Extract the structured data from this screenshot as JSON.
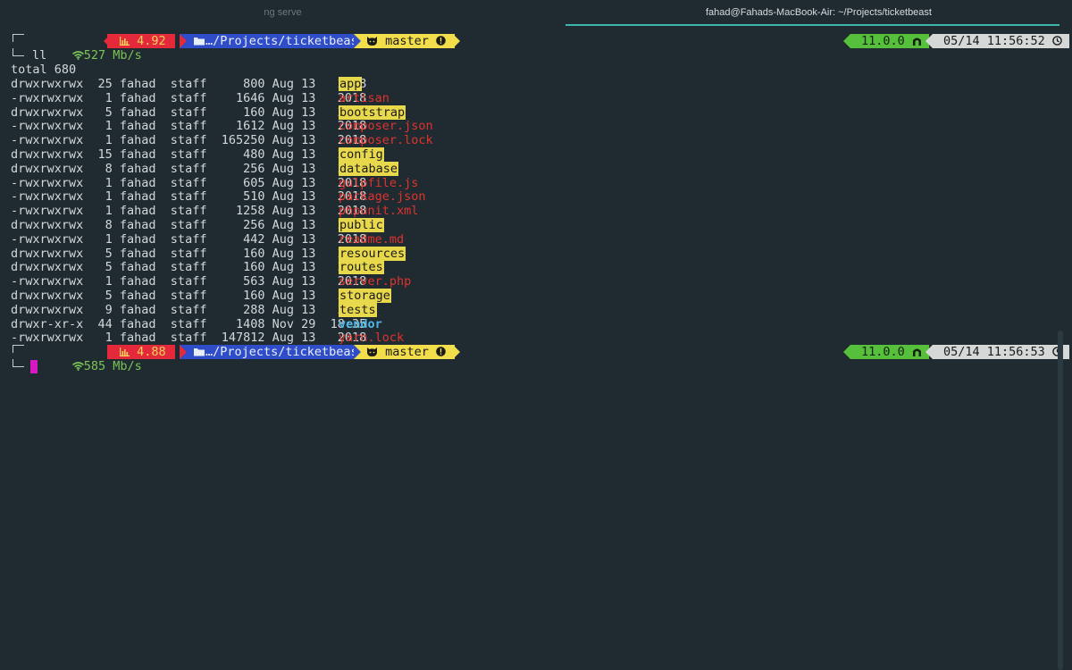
{
  "tabs": {
    "inactive": "ng serve",
    "active": "fahad@Fahads-MacBook-Air: ~/Projects/ticketbeast"
  },
  "prompt1": {
    "net": "527 Mb/s",
    "cpu": "4.92",
    "path": "…/Projects/ticketbeast",
    "branch": "master",
    "version": "11.0.0",
    "datetime": "05/14 11:56:52"
  },
  "command": "ll",
  "total": "total 680",
  "listing": [
    {
      "perm": "drwxrwxrwx",
      "links": "25",
      "user": "fahad",
      "group": "staff",
      "size": "800",
      "month": "Aug",
      "day": "13",
      "time": "2018",
      "name": "app",
      "kind": "dir"
    },
    {
      "perm": "-rwxrwxrwx",
      "links": "1",
      "user": "fahad",
      "group": "staff",
      "size": "1646",
      "month": "Aug",
      "day": "13",
      "time": "2018",
      "name": "artisan",
      "kind": "file"
    },
    {
      "perm": "drwxrwxrwx",
      "links": "5",
      "user": "fahad",
      "group": "staff",
      "size": "160",
      "month": "Aug",
      "day": "13",
      "time": "2018",
      "name": "bootstrap",
      "kind": "dir"
    },
    {
      "perm": "-rwxrwxrwx",
      "links": "1",
      "user": "fahad",
      "group": "staff",
      "size": "1612",
      "month": "Aug",
      "day": "13",
      "time": "2018",
      "name": "composer.json",
      "kind": "file"
    },
    {
      "perm": "-rwxrwxrwx",
      "links": "1",
      "user": "fahad",
      "group": "staff",
      "size": "165250",
      "month": "Aug",
      "day": "13",
      "time": "2018",
      "name": "composer.lock",
      "kind": "file"
    },
    {
      "perm": "drwxrwxrwx",
      "links": "15",
      "user": "fahad",
      "group": "staff",
      "size": "480",
      "month": "Aug",
      "day": "13",
      "time": "2018",
      "name": "config",
      "kind": "dir"
    },
    {
      "perm": "drwxrwxrwx",
      "links": "8",
      "user": "fahad",
      "group": "staff",
      "size": "256",
      "month": "Aug",
      "day": "13",
      "time": "2018",
      "name": "database",
      "kind": "dir"
    },
    {
      "perm": "-rwxrwxrwx",
      "links": "1",
      "user": "fahad",
      "group": "staff",
      "size": "605",
      "month": "Aug",
      "day": "13",
      "time": "2018",
      "name": "gulpfile.js",
      "kind": "file"
    },
    {
      "perm": "-rwxrwxrwx",
      "links": "1",
      "user": "fahad",
      "group": "staff",
      "size": "510",
      "month": "Aug",
      "day": "13",
      "time": "2018",
      "name": "package.json",
      "kind": "file"
    },
    {
      "perm": "-rwxrwxrwx",
      "links": "1",
      "user": "fahad",
      "group": "staff",
      "size": "1258",
      "month": "Aug",
      "day": "13",
      "time": "2018",
      "name": "phpunit.xml",
      "kind": "file"
    },
    {
      "perm": "drwxrwxrwx",
      "links": "8",
      "user": "fahad",
      "group": "staff",
      "size": "256",
      "month": "Aug",
      "day": "13",
      "time": "2018",
      "name": "public",
      "kind": "dir"
    },
    {
      "perm": "-rwxrwxrwx",
      "links": "1",
      "user": "fahad",
      "group": "staff",
      "size": "442",
      "month": "Aug",
      "day": "13",
      "time": "2018",
      "name": "readme.md",
      "kind": "file"
    },
    {
      "perm": "drwxrwxrwx",
      "links": "5",
      "user": "fahad",
      "group": "staff",
      "size": "160",
      "month": "Aug",
      "day": "13",
      "time": "2018",
      "name": "resources",
      "kind": "dir"
    },
    {
      "perm": "drwxrwxrwx",
      "links": "5",
      "user": "fahad",
      "group": "staff",
      "size": "160",
      "month": "Aug",
      "day": "13",
      "time": "2018",
      "name": "routes",
      "kind": "dir"
    },
    {
      "perm": "-rwxrwxrwx",
      "links": "1",
      "user": "fahad",
      "group": "staff",
      "size": "563",
      "month": "Aug",
      "day": "13",
      "time": "2018",
      "name": "server.php",
      "kind": "file"
    },
    {
      "perm": "drwxrwxrwx",
      "links": "5",
      "user": "fahad",
      "group": "staff",
      "size": "160",
      "month": "Aug",
      "day": "13",
      "time": "2018",
      "name": "storage",
      "kind": "dir"
    },
    {
      "perm": "drwxrwxrwx",
      "links": "9",
      "user": "fahad",
      "group": "staff",
      "size": "288",
      "month": "Aug",
      "day": "13",
      "time": "2018",
      "name": "tests",
      "kind": "dir"
    },
    {
      "perm": "drwxr-xr-x",
      "links": "44",
      "user": "fahad",
      "group": "staff",
      "size": "1408",
      "month": "Nov",
      "day": "29",
      "time": "18:35",
      "name": "vendor",
      "kind": "exe"
    },
    {
      "perm": "-rwxrwxrwx",
      "links": "1",
      "user": "fahad",
      "group": "staff",
      "size": "147812",
      "month": "Aug",
      "day": "13",
      "time": "2018",
      "name": "yarn.lock",
      "kind": "file"
    }
  ],
  "prompt2": {
    "net": "585 Mb/s",
    "cpu": "4.88",
    "path": "…/Projects/ticketbeast",
    "branch": "master",
    "version": "11.0.0",
    "datetime": "05/14 11:56:53"
  },
  "icons": {
    "wifi": "wifi-icon",
    "cpu": "bar-chart-icon",
    "folder": "folder-icon",
    "github": "github-cat-icon",
    "warning": "exclamation-circle-icon",
    "node": "node-arch-icon",
    "clock": "clock-icon"
  },
  "colors": {
    "background": "#1f2b30",
    "cpu_segment": "#e3293a",
    "path_segment": "#2f4dc8",
    "git_segment": "#f2de4a",
    "version_segment": "#56bf3c",
    "time_segment": "#d6d7d7",
    "cursor": "#d619c3",
    "tab_accent": "#3fb6ad"
  }
}
